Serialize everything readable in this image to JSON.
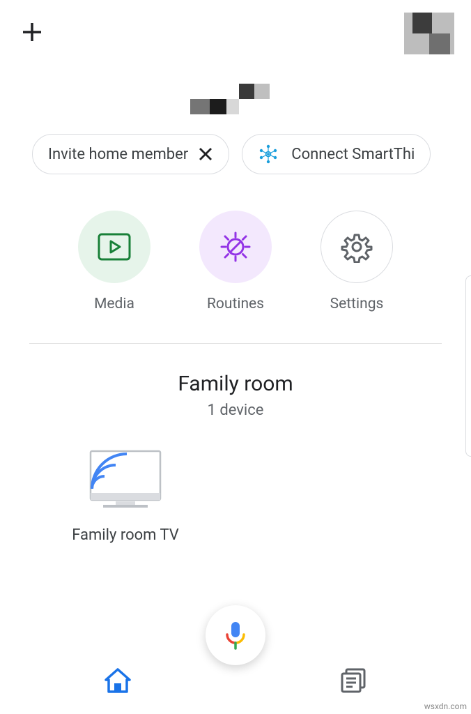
{
  "chips": {
    "invite": {
      "label": "Invite home member"
    },
    "smartthings": {
      "label": "Connect SmartThi"
    }
  },
  "quick": {
    "media": "Media",
    "routines": "Routines",
    "settings": "Settings"
  },
  "room": {
    "name": "Family room",
    "count": "1 device"
  },
  "devices": [
    {
      "name": "Family room TV"
    }
  ],
  "watermark": "wsxdn.com"
}
